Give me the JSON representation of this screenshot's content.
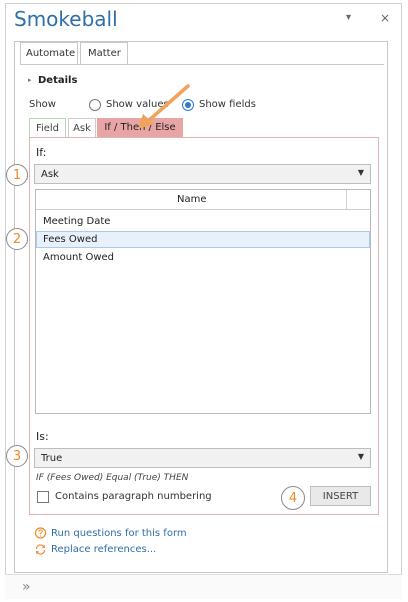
{
  "app": {
    "title": "Smokeball",
    "menu_glyph": "▾",
    "close_glyph": "×"
  },
  "main_tabs": [
    {
      "label": "Automate"
    },
    {
      "label": "Matter"
    }
  ],
  "details": {
    "label": "Details",
    "expander": "▸"
  },
  "show": {
    "label": "Show",
    "options": [
      {
        "label": "Show values",
        "selected": false
      },
      {
        "label": "Show fields",
        "selected": true
      }
    ]
  },
  "subtabs": [
    {
      "label": "Field"
    },
    {
      "label": "Ask"
    },
    {
      "label": "If / Then / Else",
      "active": true
    }
  ],
  "if_section": {
    "label": "If:",
    "dropdown_value": "Ask",
    "grid_header": "Name",
    "rows": [
      {
        "label": "Meeting Date"
      },
      {
        "label": "Fees Owed",
        "selected": true
      },
      {
        "label": "Amount Owed"
      }
    ]
  },
  "is_section": {
    "label": "Is:",
    "dropdown_value": "True",
    "expression": "IF (Fees Owed) Equal (True) THEN",
    "checkbox_label": "Contains paragraph numbering",
    "checkbox_checked": false,
    "insert_label": "INSERT"
  },
  "callouts": [
    {
      "number": "1"
    },
    {
      "number": "2"
    },
    {
      "number": "3"
    },
    {
      "number": "4"
    }
  ],
  "links": [
    {
      "label": "Run questions for this form",
      "icon": "question-icon"
    },
    {
      "label": "Replace references...",
      "icon": "replace-icon"
    }
  ],
  "footer": {
    "expand_glyph": "»"
  },
  "colors": {
    "accent": "#2f6fa8",
    "active_subtab": "#e8a5a5",
    "callout_text": "#f08a2b",
    "arrow": "#f0a35a"
  }
}
